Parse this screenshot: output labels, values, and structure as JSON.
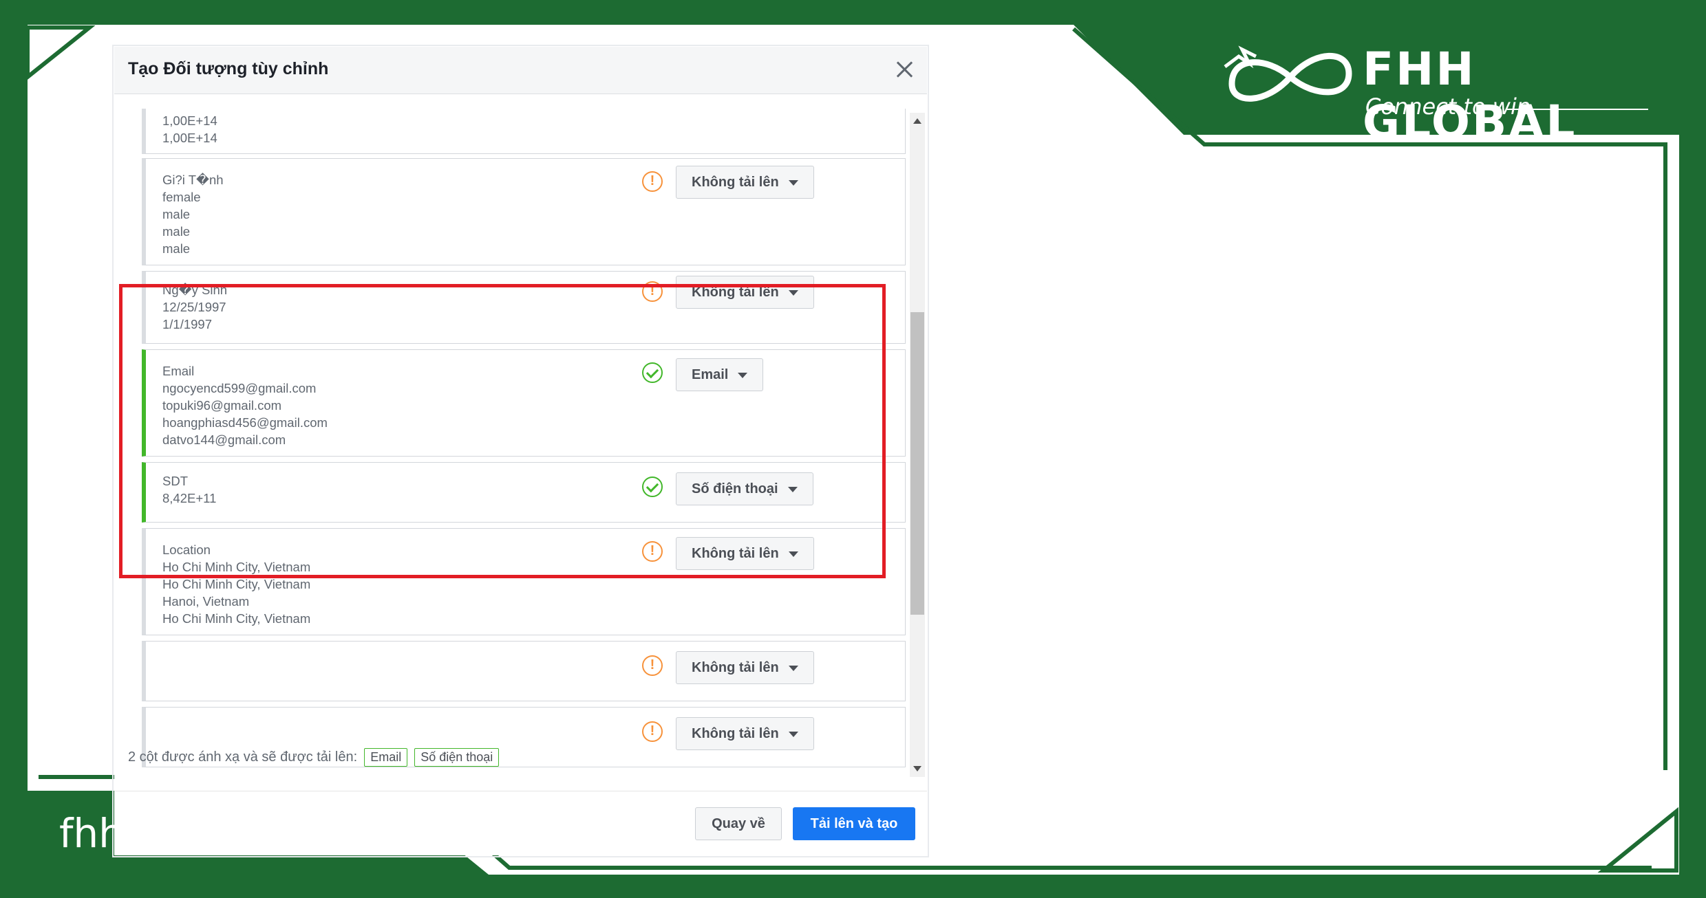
{
  "brand": {
    "name": "FHH GLOBAL",
    "tagline": "Connect to win",
    "website": "fhh-global.com"
  },
  "dialog": {
    "title": "Tạo Đối tượng tùy chỉnh",
    "rows": [
      {
        "lines": [
          "1,00E+14",
          "1,00E+14"
        ],
        "status": "none",
        "button": ""
      },
      {
        "lines": [
          "Gi?i T�nh",
          "female",
          "male",
          "male",
          "male"
        ],
        "status": "warning",
        "button": "Không tải lên"
      },
      {
        "lines": [
          "Ng�y Sinh",
          "12/25/1997",
          "1/1/1997"
        ],
        "status": "warning",
        "button": "Không tải lên"
      },
      {
        "lines": [
          "Email",
          "ngocyencd599@gmail.com",
          "topuki96@gmail.com",
          "hoangphiasd456@gmail.com",
          "datvo144@gmail.com"
        ],
        "status": "ok",
        "button": "Email"
      },
      {
        "lines": [
          "SDT",
          "8,42E+11"
        ],
        "status": "ok",
        "button": "Số điện thoại"
      },
      {
        "lines": [
          "Location",
          "Ho Chi Minh City, Vietnam",
          "Ho Chi Minh City, Vietnam",
          "Hanoi, Vietnam",
          "Ho Chi Minh City, Vietnam"
        ],
        "status": "warning",
        "button": "Không tải lên"
      },
      {
        "lines": [],
        "status": "warning",
        "button": "Không tải lên"
      },
      {
        "lines": [],
        "status": "warning",
        "button": "Không tải lên"
      }
    ],
    "footer": {
      "note": "2 cột được ánh xạ và sẽ được tải lên:",
      "chips": [
        "Email",
        "Số điện thoại"
      ],
      "back_label": "Quay về",
      "upload_label": "Tải lên và tạo"
    }
  },
  "colors": {
    "frame_green": "#1d6b32",
    "highlight_red": "#e21d25",
    "primary_blue": "#1877f2",
    "ok_green": "#42b72a",
    "warn_orange": "#f7923b"
  }
}
